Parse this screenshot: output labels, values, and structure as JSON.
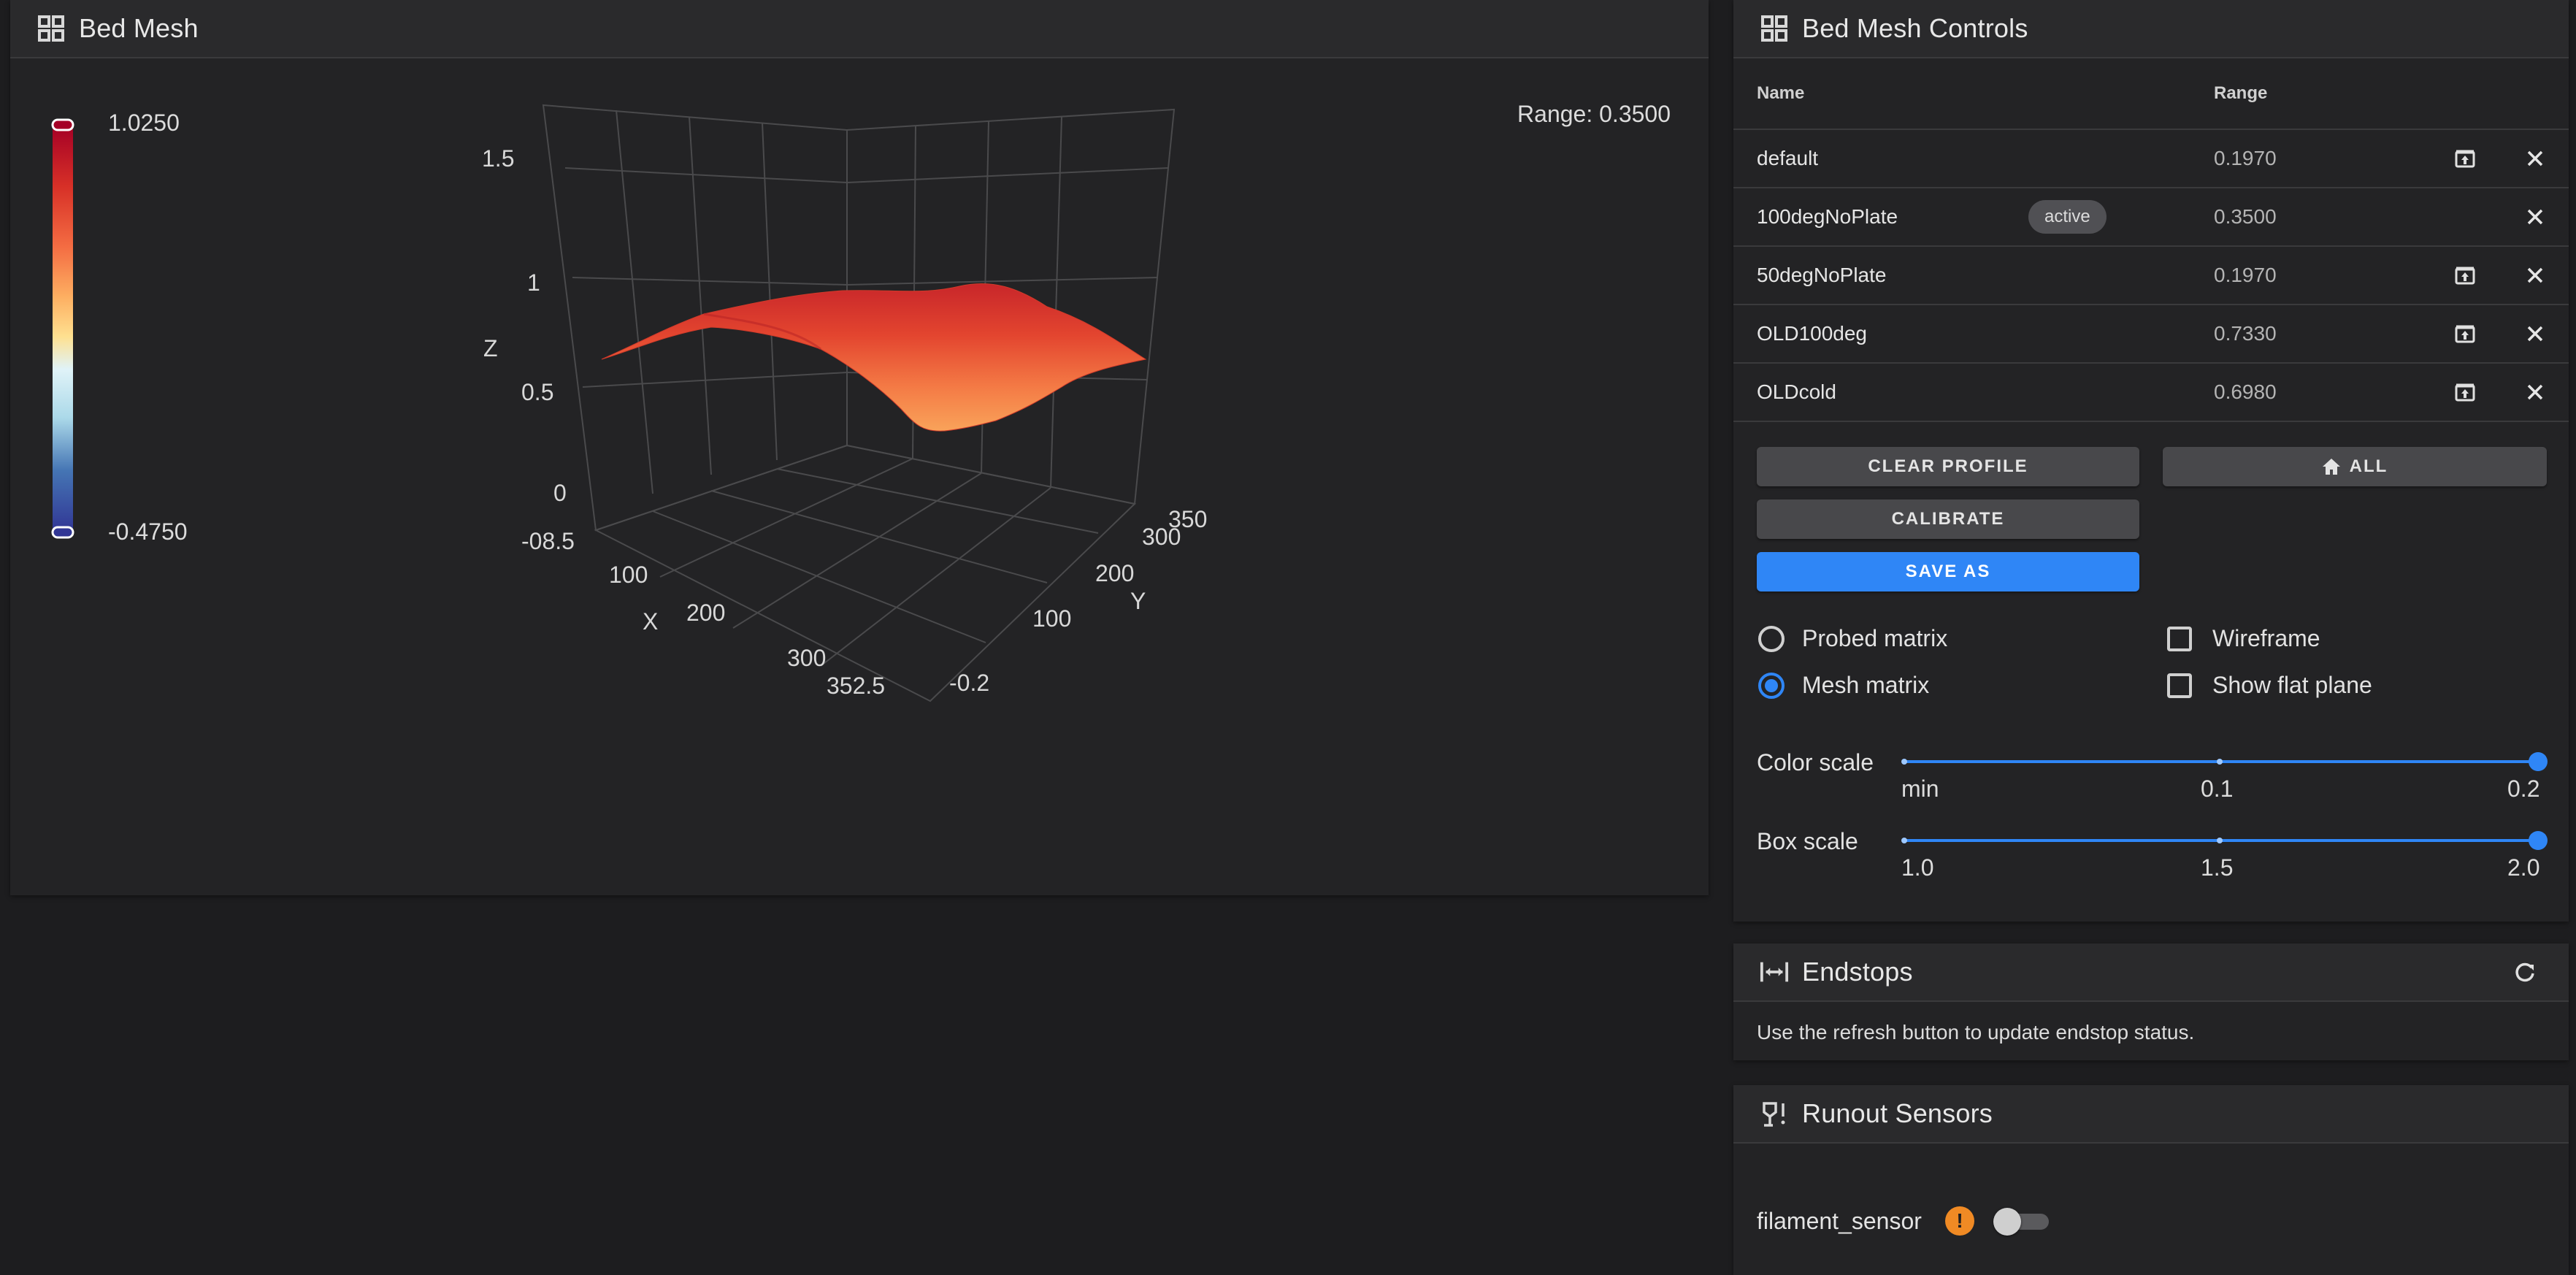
{
  "bed_mesh": {
    "title": "Bed Mesh",
    "icon": "grid-icon",
    "range_text": "Range: 0.3500",
    "colorbar": {
      "max": "1.0250",
      "min": "-0.4750"
    },
    "axes": {
      "z_label": "Z",
      "x_label": "X",
      "y_label": "Y",
      "z_ticks": [
        "1.5",
        "1",
        "0.5",
        "0"
      ],
      "x_ticks": [
        "100",
        "200",
        "300",
        "352.5"
      ],
      "y_ticks": [
        "350",
        "300",
        "200",
        "100"
      ],
      "corner_left": "-08.5",
      "corner_bottom": "-0.2"
    }
  },
  "controls": {
    "title": "Bed Mesh Controls",
    "icon": "grid-icon",
    "columns": {
      "name": "Name",
      "range": "Range"
    },
    "profiles": [
      {
        "name": "default",
        "range": "0.1970",
        "active": false,
        "loadable": true
      },
      {
        "name": "100degNoPlate",
        "range": "0.3500",
        "active": true,
        "loadable": false
      },
      {
        "name": "50degNoPlate",
        "range": "0.1970",
        "active": false,
        "loadable": true
      },
      {
        "name": "OLD100deg",
        "range": "0.7330",
        "active": false,
        "loadable": true
      },
      {
        "name": "OLDcold",
        "range": "0.6980",
        "active": false,
        "loadable": true
      }
    ],
    "active_chip": "active",
    "buttons": {
      "clear_profile": "CLEAR PROFILE",
      "home_all": "ALL",
      "calibrate": "CALIBRATE",
      "save_as": "SAVE AS"
    },
    "options": {
      "probed_matrix": "Probed matrix",
      "mesh_matrix": "Mesh matrix",
      "wireframe": "Wireframe",
      "show_flat_plane": "Show flat plane",
      "selected_matrix": "mesh_matrix",
      "wireframe_checked": false,
      "flat_plane_checked": false
    },
    "color_scale": {
      "label": "Color scale",
      "ticks": [
        "min",
        "0.1",
        "0.2"
      ],
      "value": 0.2
    },
    "box_scale": {
      "label": "Box scale",
      "ticks": [
        "1.0",
        "1.5",
        "2.0"
      ],
      "value": 2.0
    }
  },
  "endstops": {
    "title": "Endstops",
    "icon": "endstops-icon",
    "message": "Use the refresh button to update endstop status."
  },
  "runout": {
    "title": "Runout Sensors",
    "icon": "runout-sensor-icon",
    "sensor_name": "filament_sensor",
    "sensor_enabled": false,
    "warning_glyph": "!"
  },
  "colors": {
    "accent": "#2f86f6",
    "warning": "#f08a24"
  }
}
